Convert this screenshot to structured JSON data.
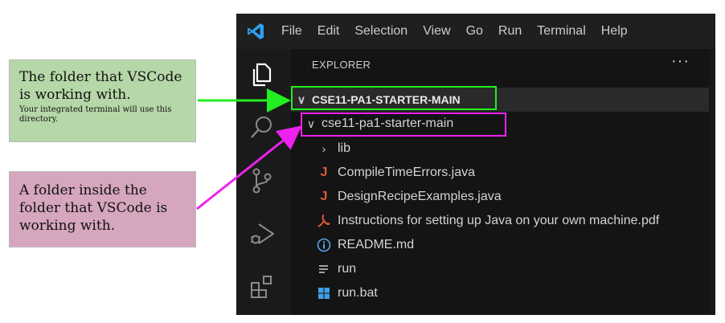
{
  "annotations": {
    "green_note": {
      "line1": "The folder that VSCode",
      "line2": "is working with.",
      "small": "Your integrated terminal will use this directory."
    },
    "pink_note": {
      "line1": "A folder inside the",
      "line2": "folder that VSCode is",
      "line3": "working with."
    }
  },
  "menu": [
    "File",
    "Edit",
    "Selection",
    "View",
    "Go",
    "Run",
    "Terminal",
    "Help"
  ],
  "explorer": {
    "title": "EXPLORER",
    "more": "···",
    "root": "CSE11-PA1-STARTER-MAIN",
    "subfolder": "cse11-pa1-starter-main",
    "items": [
      {
        "name": "lib",
        "icon": "chevron-right-icon",
        "kind": "folder"
      },
      {
        "name": "CompileTimeErrors.java",
        "icon": "java-icon",
        "kind": "file"
      },
      {
        "name": "DesignRecipeExamples.java",
        "icon": "java-icon",
        "kind": "file"
      },
      {
        "name": "Instructions for setting up Java on your own machine.pdf",
        "icon": "pdf-icon",
        "kind": "file"
      },
      {
        "name": "README.md",
        "icon": "info-icon",
        "kind": "file"
      },
      {
        "name": "run",
        "icon": "lines-icon",
        "kind": "file"
      },
      {
        "name": "run.bat",
        "icon": "windows-icon",
        "kind": "file"
      }
    ]
  },
  "colors": {
    "green_highlight": "#22ee22",
    "magenta_highlight": "#ee22ee",
    "java_icon": "#e05a3a",
    "pdf_icon": "#e05a3a",
    "info_icon": "#5aa5ea",
    "windows_icon": "#3ea0e8"
  }
}
